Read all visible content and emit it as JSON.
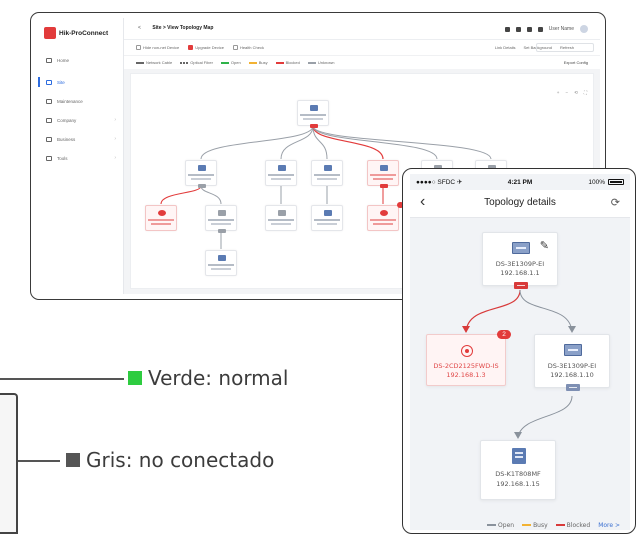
{
  "desktop": {
    "brand": "Hik-ProConnect",
    "breadcrumb_back": "<",
    "breadcrumb": "Site > View Topology Map",
    "user": "User Name",
    "sidebar": [
      {
        "label": "Home"
      },
      {
        "label": "Site"
      },
      {
        "label": "Maintenance"
      },
      {
        "label": "Company"
      },
      {
        "label": "Business"
      },
      {
        "label": "Tools"
      }
    ],
    "toolbar": [
      "Hide non-net Device",
      "Upgrade Device",
      "Health Check"
    ],
    "toolbar_right": [
      "Link Details",
      "Set Background",
      "Refresh"
    ],
    "legend": [
      "Network Cable",
      "Optical Fiber",
      "Open",
      "Busy",
      "Blocked",
      "Unknown"
    ],
    "export_label": "Export Config",
    "zoom_controls": [
      "+",
      "−",
      "⟲",
      "⛶"
    ],
    "colors": {
      "open": "#2fb34a",
      "busy": "#f2b233",
      "blocked": "#e23b3b",
      "unknown": "#9aa0a8",
      "brand": "#e23b3b",
      "accent": "#2d6cdf"
    }
  },
  "status_legend": {
    "green": {
      "label": "Verde: normal",
      "color": "#2ecc40"
    },
    "gray": {
      "label": "Gris: no conectado",
      "color": "#555555"
    }
  },
  "phone": {
    "carrier": "●●●●○ SFDC ✈",
    "time": "4:21 PM",
    "battery": "100%",
    "title": "Topology details",
    "root": {
      "name": "DS-3E1309P-EI",
      "ip": "192.168.1.1"
    },
    "left": {
      "name": "DS-2CD2125FWD-IS",
      "ip": "192.168.1.3",
      "alarm_count": "2"
    },
    "right": {
      "name": "DS-3E1309P-EI",
      "ip": "192.168.1.10"
    },
    "bottom": {
      "name": "DS-K1T808MF",
      "ip": "192.168.1.15"
    },
    "legend": {
      "open": "Open",
      "busy": "Busy",
      "blocked": "Blocked",
      "more": "More >"
    },
    "colors": {
      "open": "#8a929c",
      "busy": "#f2b233",
      "blocked": "#d83a3a"
    }
  }
}
